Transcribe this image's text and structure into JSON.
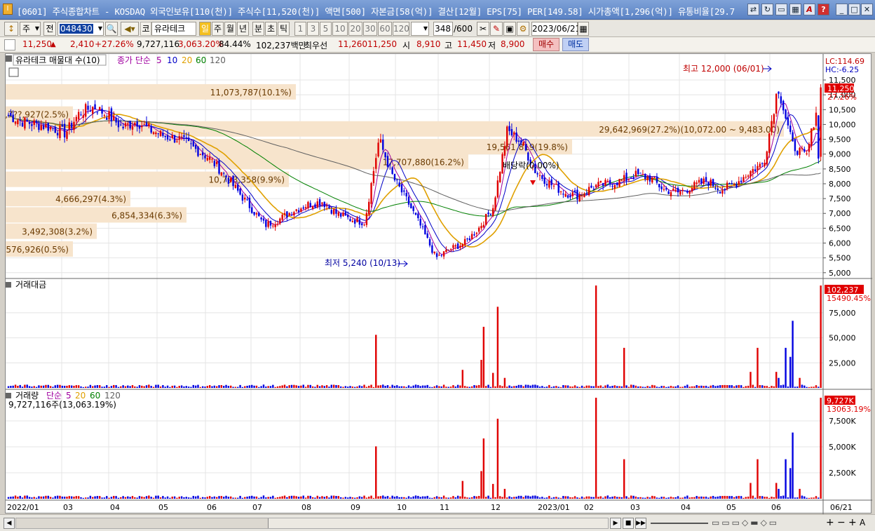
{
  "window": {
    "title": "[0601] 주식종합차트 - KOSDAQ 외국인보유[110(천)] 주식수[11,520(천)] 액면[500] 자본금[58(억)] 결산[12월] EPS[75] PER[149.58] 시가총액[1,296(억)] 유통비율[29.7"
  },
  "toolbar": {
    "type": "주",
    "prev": "전",
    "code": "048430",
    "market": "코",
    "name": "유라테크",
    "periods": [
      "일",
      "주",
      "월",
      "년",
      "분",
      "초",
      "틱"
    ],
    "intervals": [
      "1",
      "3",
      "5",
      "10",
      "20",
      "30",
      "60",
      "120"
    ],
    "count": "348",
    "count_max": "/600",
    "date": "2023/06/21"
  },
  "quote": {
    "price": "11,250",
    "change": "2,410",
    "change_pct": "+27.26%",
    "volume": "9,727,116",
    "volume_pct": "3,063.20%",
    "turnover_ratio": "84.44%",
    "amount": "102,237백만",
    "best_label": "최우선",
    "ask": "11,260",
    "bid": "11,250",
    "open_label": "시",
    "open": "8,910",
    "high_label": "고",
    "high": "11,450",
    "low_label": "저",
    "low": "8,900",
    "buy_button": "매수",
    "sell_button": "매도"
  },
  "main_panel": {
    "legend_title": "유라테크 매물대 수(10)",
    "ma_label": "종가 단순",
    "ma_periods": [
      "5",
      "10",
      "20",
      "60",
      "120"
    ],
    "ma_colors": [
      "#a000a0",
      "#0000c8",
      "#e0a000",
      "#008000",
      "#606060"
    ],
    "lc": "LC:114.69",
    "hc": "HC:-6.25",
    "price_tag": "11,250",
    "pct_tag": "27.26%",
    "high_note": "최고 12,000 (06/01)",
    "low_note": "최저 5,240 (10/13)",
    "dividend_note": "배당락(0.00%)",
    "profile_labels": [
      "11,073,787(10.1%)",
      "29,642,969(27.2%)(10,072.00 ~ 9,483.00)",
      "2,7??,927(2.5%)",
      "19,561,819(19.8%)",
      "17,707,880(16.2%)",
      "10,793,358(9.9%)",
      "4,666,297(4.3%)",
      "6,854,334(6.3%)",
      "3,492,308(3.2%)",
      "576,926(0.5%)"
    ]
  },
  "amount_panel": {
    "title": "거래대금",
    "tag": "102,237",
    "tag2": "15490.45%"
  },
  "volume_panel": {
    "title": "거래량",
    "ma_label": "단순",
    "ma_periods": [
      "5",
      "20",
      "60",
      "120"
    ],
    "summary": "9,727,116주(13,063.19%)",
    "tag": "9,727K",
    "tag2": "13063.19%"
  },
  "x_axis": {
    "labels": [
      "2022/01",
      "03",
      "04",
      "05",
      "06",
      "07",
      "08",
      "09",
      "10",
      "11",
      "12",
      "2023/01",
      "02",
      "03",
      "04",
      "05",
      "06"
    ],
    "last": "06/21"
  },
  "chart_data": {
    "type": "candlestick",
    "price_axis": {
      "ticks": [
        5000,
        5500,
        6000,
        6500,
        7000,
        7500,
        8000,
        8500,
        9000,
        9500,
        10000,
        10500,
        11000,
        11500
      ],
      "min": 4900,
      "max": 11950
    },
    "amount_axis": {
      "ticks": [
        25000,
        50000,
        75000
      ],
      "max": 102237
    },
    "volume_axis": {
      "ticks": [
        "2,500K",
        "5,000K",
        "7,500K"
      ],
      "max": 9727
    },
    "close_path": [
      [
        "2022/01",
        10300
      ],
      [
        "01",
        10100
      ],
      [
        "01",
        10000
      ],
      [
        "02",
        9900
      ],
      [
        "02",
        9700
      ],
      [
        "03",
        10400
      ],
      [
        "03",
        10600
      ],
      [
        "03",
        10300
      ],
      [
        "04",
        9900
      ],
      [
        "04",
        10100
      ],
      [
        "04",
        9800
      ],
      [
        "05",
        9600
      ],
      [
        "05",
        9500
      ],
      [
        "05",
        9200
      ],
      [
        "06",
        8900
      ],
      [
        "06",
        8400
      ],
      [
        "06",
        7800
      ],
      [
        "06",
        7200
      ],
      [
        "07",
        6600
      ],
      [
        "07",
        6800
      ],
      [
        "07",
        7100
      ],
      [
        "08",
        7300
      ],
      [
        "08",
        7400
      ],
      [
        "08",
        7000
      ],
      [
        "09",
        6800
      ],
      [
        "09",
        6700
      ],
      [
        "09",
        9500
      ],
      [
        "09",
        8200
      ],
      [
        "10",
        7400
      ],
      [
        "10",
        6500
      ],
      [
        "10",
        5500
      ],
      [
        "10",
        5800
      ],
      [
        "11",
        6000
      ],
      [
        "11",
        6500
      ],
      [
        "11",
        7200
      ],
      [
        "11",
        9800
      ],
      [
        "12",
        9400
      ],
      [
        "12",
        8400
      ],
      [
        "12",
        8000
      ],
      [
        "12",
        7700
      ],
      [
        "2023/01",
        7600
      ],
      [
        "01",
        7900
      ],
      [
        "01",
        8000
      ],
      [
        "02",
        8100
      ],
      [
        "02",
        8300
      ],
      [
        "03",
        8200
      ],
      [
        "03",
        7800
      ],
      [
        "03",
        7700
      ],
      [
        "04",
        7900
      ],
      [
        "04",
        8100
      ],
      [
        "04",
        7800
      ],
      [
        "05",
        8000
      ],
      [
        "05",
        8400
      ],
      [
        "05",
        8700
      ],
      [
        "06",
        11300
      ],
      [
        "06",
        9300
      ],
      [
        "06",
        8900
      ],
      [
        "06",
        11250
      ]
    ],
    "amount_bars_note": "daily trading amount (millions KRW), spikes at 09, 11, 12, 03, 05, 06",
    "volume_spikes": [
      {
        "x": "09",
        "value": 6000
      },
      {
        "x": "11",
        "value": 5300
      },
      {
        "x": "11",
        "value": 7900
      },
      {
        "x": "12",
        "value": 3200
      },
      {
        "x": "03",
        "value": 4700
      },
      {
        "x": "05",
        "value": 4700
      },
      {
        "x": "06",
        "value": 6000
      },
      {
        "x": "06",
        "value": 9727
      }
    ]
  }
}
